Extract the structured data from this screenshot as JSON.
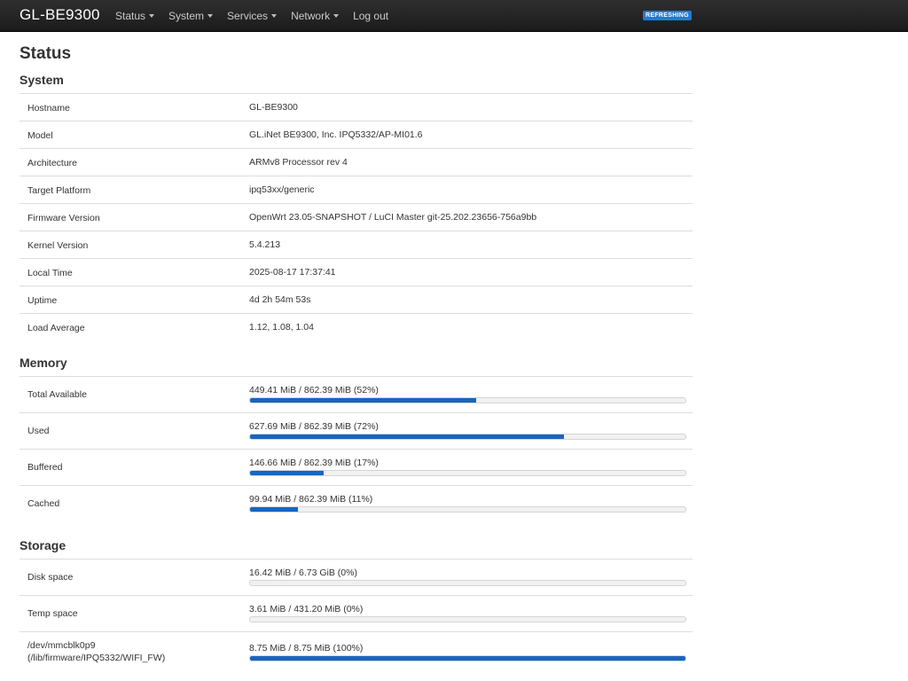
{
  "navbar": {
    "brand": "GL-BE9300",
    "menu": [
      {
        "label": "Status",
        "dropdown": true
      },
      {
        "label": "System",
        "dropdown": true
      },
      {
        "label": "Services",
        "dropdown": true
      },
      {
        "label": "Network",
        "dropdown": true
      },
      {
        "label": "Log out",
        "dropdown": false
      }
    ],
    "indicator": "REFRESHING"
  },
  "page": {
    "title": "Status"
  },
  "system": {
    "title": "System",
    "rows": [
      {
        "label": "Hostname",
        "value": "GL-BE9300"
      },
      {
        "label": "Model",
        "value": "GL.iNet BE9300, Inc. IPQ5332/AP-MI01.6"
      },
      {
        "label": "Architecture",
        "value": "ARMv8 Processor rev 4"
      },
      {
        "label": "Target Platform",
        "value": "ipq53xx/generic"
      },
      {
        "label": "Firmware Version",
        "value": "OpenWrt 23.05-SNAPSHOT / LuCI Master git-25.202.23656-756a9bb"
      },
      {
        "label": "Kernel Version",
        "value": "5.4.213"
      },
      {
        "label": "Local Time",
        "value": "2025-08-17 17:37:41"
      },
      {
        "label": "Uptime",
        "value": "4d 2h 54m 53s"
      },
      {
        "label": "Load Average",
        "value": "1.12, 1.08, 1.04"
      }
    ]
  },
  "memory": {
    "title": "Memory",
    "rows": [
      {
        "label": "Total Available",
        "value": "449.41 MiB / 862.39 MiB (52%)",
        "percent": 52
      },
      {
        "label": "Used",
        "value": "627.69 MiB / 862.39 MiB (72%)",
        "percent": 72
      },
      {
        "label": "Buffered",
        "value": "146.66 MiB / 862.39 MiB (17%)",
        "percent": 17
      },
      {
        "label": "Cached",
        "value": "99.94 MiB / 862.39 MiB (11%)",
        "percent": 11
      }
    ]
  },
  "storage": {
    "title": "Storage",
    "rows": [
      {
        "label": "Disk space",
        "value": "16.42 MiB / 6.73 GiB (0%)",
        "percent": 0
      },
      {
        "label": "Temp space",
        "value": "3.61 MiB / 431.20 MiB (0%)",
        "percent": 0
      },
      {
        "label": "/dev/mmcblk0p9",
        "label2": "(/lib/firmware/IPQ5332/WIFI_FW)",
        "value": "8.75 MiB / 8.75 MiB (100%)",
        "percent": 100
      }
    ]
  },
  "colors": {
    "navbar": "#1f1f1f",
    "accent": "#1865c1",
    "badge": "#1f7bd7"
  }
}
